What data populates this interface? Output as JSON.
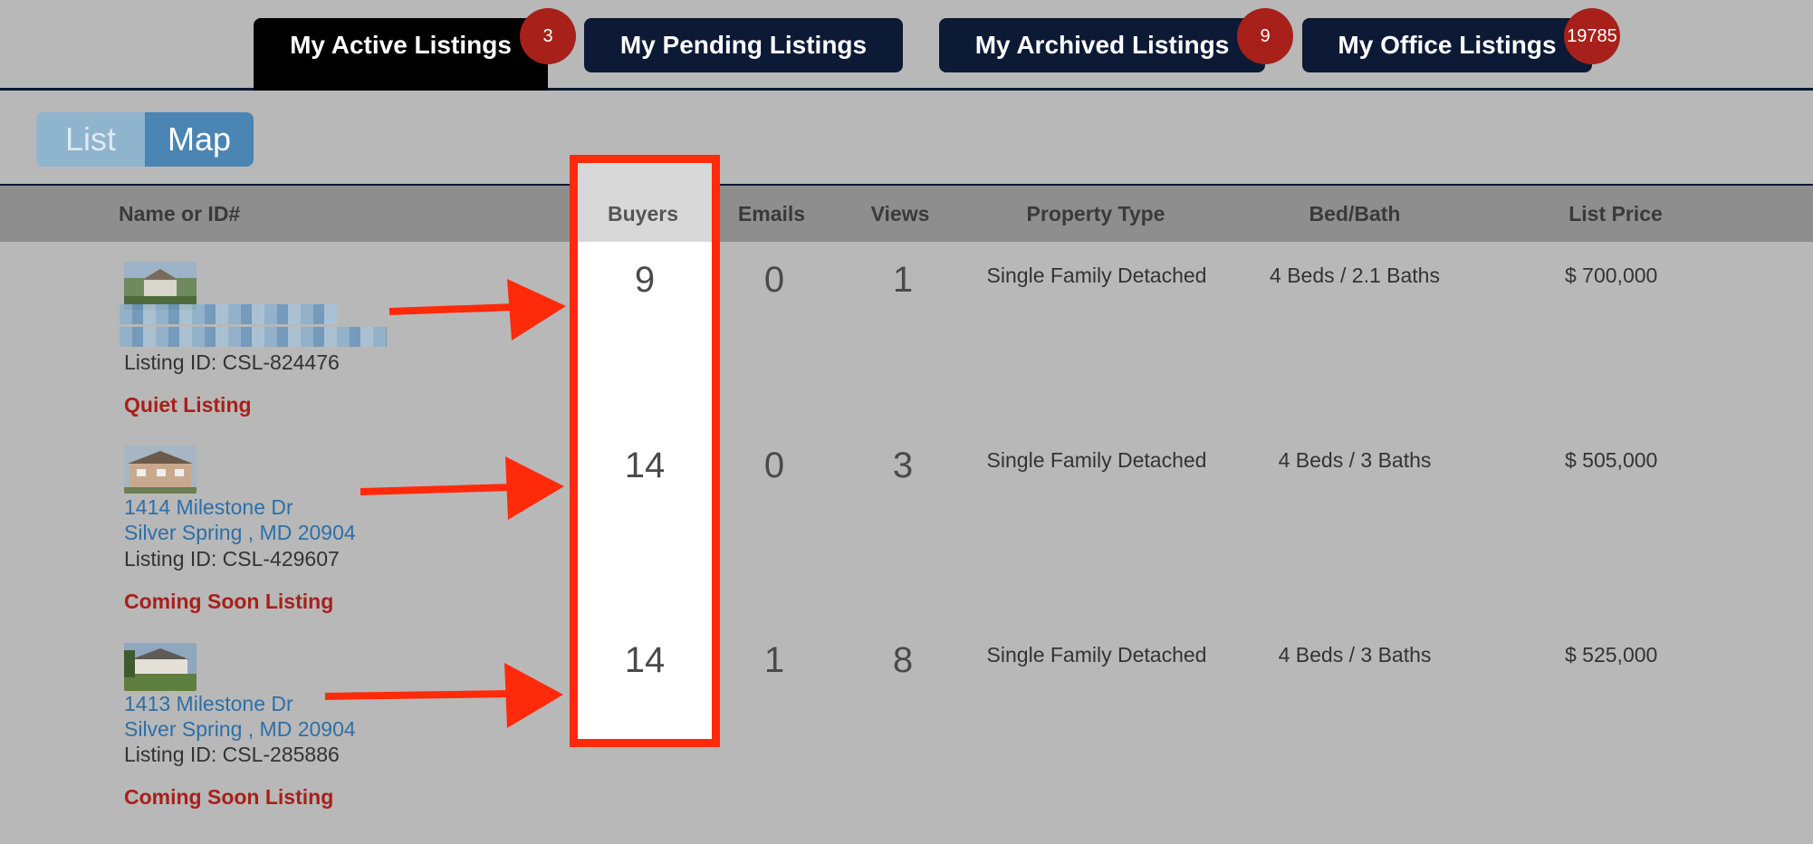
{
  "tabs": [
    {
      "label": "My Active Listings",
      "badge": "3"
    },
    {
      "label": "My Pending Listings",
      "badge": ""
    },
    {
      "label": "My Archived Listings",
      "badge": "9"
    },
    {
      "label": "My Office Listings",
      "badge": "19785"
    }
  ],
  "view_toggle": {
    "list_label": "List",
    "map_label": "Map",
    "selected": "Map"
  },
  "table": {
    "columns": [
      "Name or ID#",
      "Buyers",
      "Emails",
      "Views",
      "Property Type",
      "Bed/Bath",
      "List Price"
    ],
    "rows": [
      {
        "address_line1": "",
        "address_line2": "",
        "listing_id": "Listing ID: CSL-824476",
        "status": "Quiet Listing",
        "buyers": "9",
        "emails": "0",
        "views": "1",
        "property_type": "Single Family Detached",
        "bed_bath": "4 Beds / 2.1 Baths",
        "price": "$ 700,000"
      },
      {
        "address_line1": "1414 Milestone Dr",
        "address_line2": "Silver Spring , MD 20904",
        "listing_id": "Listing ID: CSL-429607",
        "status": "Coming Soon Listing",
        "buyers": "14",
        "emails": "0",
        "views": "3",
        "property_type": "Single Family Detached",
        "bed_bath": "4 Beds / 3 Baths",
        "price": "$ 505,000"
      },
      {
        "address_line1": "1413 Milestone Dr",
        "address_line2": "Silver Spring , MD 20904",
        "listing_id": "Listing ID: CSL-285886",
        "status": "Coming Soon Listing",
        "buyers": "14",
        "emails": "1",
        "views": "8",
        "property_type": "Single Family Detached",
        "bed_bath": "4 Beds / 3 Baths",
        "price": "$ 525,000"
      }
    ]
  },
  "colors": {
    "highlight": "#ff2a0a",
    "tab_bg": "#0c1a36",
    "active_tab_bg": "#000000",
    "badge": "#a8201a",
    "link": "#2e6fa7",
    "status": "#a8201a"
  }
}
